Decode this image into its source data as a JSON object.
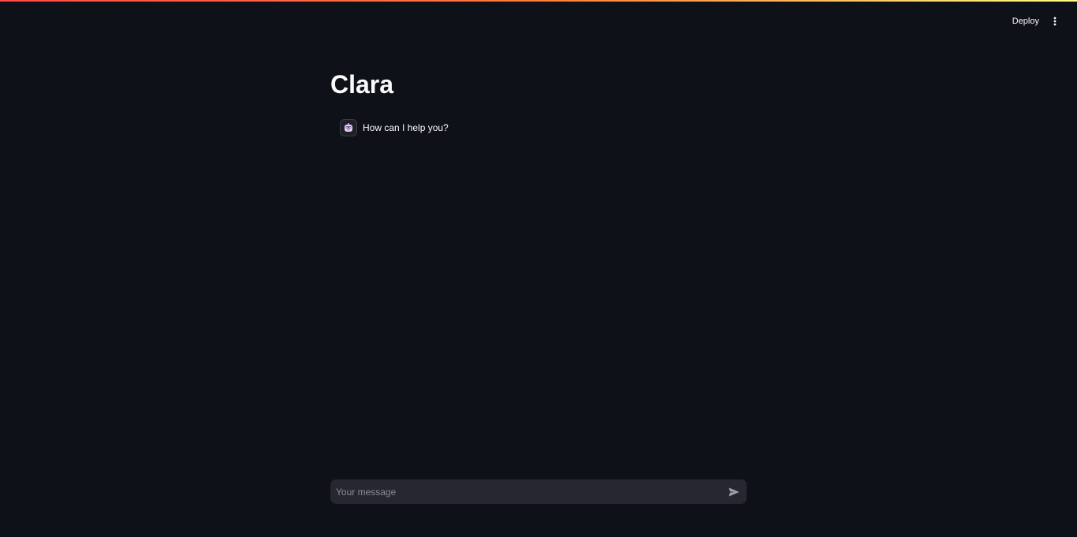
{
  "header": {
    "deploy_label": "Deploy",
    "menu_icon": "more-vertical-icon"
  },
  "main": {
    "title": "Clara"
  },
  "chat": {
    "messages": [
      {
        "role": "assistant",
        "avatar_icon": "robot-icon",
        "text": "How can I help you?"
      }
    ],
    "input": {
      "placeholder": "Your message",
      "value": ""
    },
    "send_icon": "send-icon"
  },
  "colors": {
    "background": "#0e1117",
    "input_background": "#262730",
    "text": "#fafafa",
    "placeholder": "#8b8c94",
    "decoration_start": "#ff4b4b",
    "decoration_end": "#fffd80"
  }
}
